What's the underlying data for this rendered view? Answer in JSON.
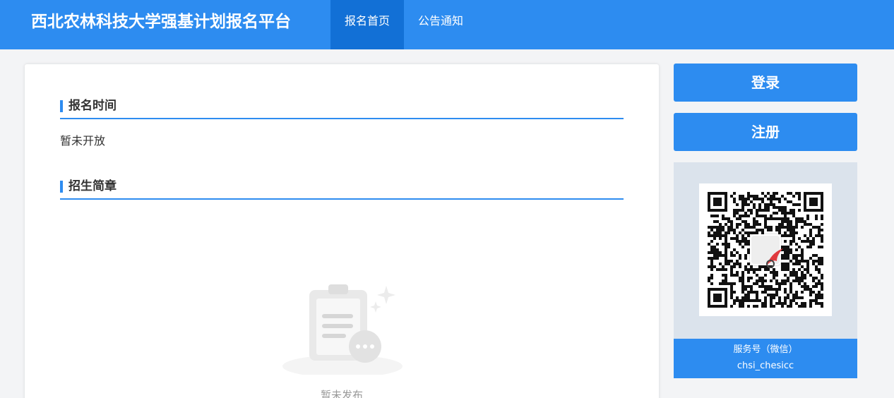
{
  "header": {
    "title": "西北农林科技大学强基计划报名平台",
    "nav": [
      {
        "label": "报名首页",
        "active": true
      },
      {
        "label": "公告通知",
        "active": false
      }
    ]
  },
  "main": {
    "sections": [
      {
        "title": "报名时间",
        "content": "暂未开放"
      },
      {
        "title": "招生简章",
        "empty_text": "暂未发布"
      }
    ]
  },
  "sidebar": {
    "login_label": "登录",
    "register_label": "注册",
    "qr": {
      "caption_line1": "服务号（微信）",
      "caption_line2": "chsi_chesicc"
    }
  },
  "colors": {
    "primary": "#2d8cf0",
    "nav_active": "#1270d6",
    "qr_panel_bg": "#dbe3ec",
    "page_bg": "#f3f4f6"
  }
}
